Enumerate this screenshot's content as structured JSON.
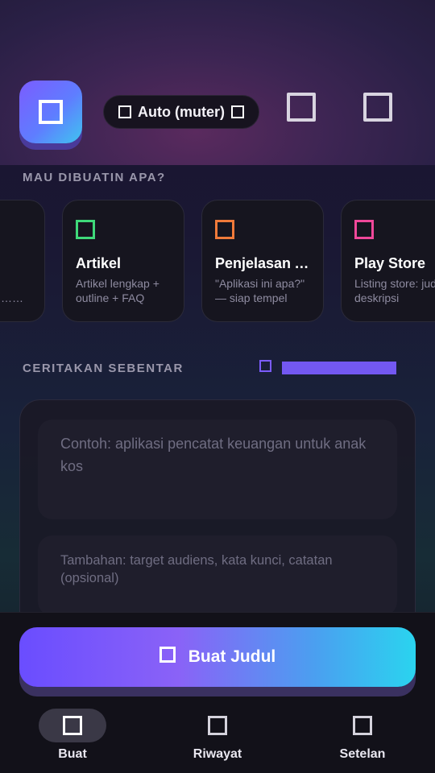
{
  "header": {
    "logo_icon": "app-logo-icon",
    "mode_label": "Auto (muter)",
    "mode_left_icon": "mode-icon",
    "mode_right_icon": "mode-toggle-icon",
    "action_icons": [
      "history-icon",
      "more-icon"
    ]
  },
  "templates": {
    "section_label": "MAU DIBUATIN APA?",
    "cards": [
      {
        "title": "",
        "desc": "…ngk…",
        "icon": "template-icon",
        "color": "#5a5a66"
      },
      {
        "title": "Artikel",
        "desc": "Artikel lengkap + outline + FAQ",
        "icon": "article-icon",
        "color": "#3fd97a"
      },
      {
        "title": "Penjelasan Aplikasi",
        "desc": "\"Aplikasi ini apa?\" — siap tempel",
        "icon": "app-explainer-icon",
        "color": "#f07a3a"
      },
      {
        "title": "Play Store",
        "desc": "Listing store: judul, deskripsi",
        "icon": "play-store-icon",
        "color": "#f0489a"
      }
    ]
  },
  "story": {
    "section_label": "CERITAKAN SEBENTAR",
    "tone_icon": "tone-icon",
    "tone_level": 1.0,
    "accent": "#7358f2",
    "main_placeholder": "Contoh: aplikasi pencatat keuangan untuk anak kos",
    "extra_placeholder": "Tambahan: target audiens, kata kunci, catatan (opsional)"
  },
  "cta": {
    "label": "Buat Judul",
    "icon": "sparkle-icon"
  },
  "bottom_nav": {
    "items": [
      {
        "label": "Buat",
        "icon": "create-icon",
        "active": true
      },
      {
        "label": "Riwayat",
        "icon": "history-icon",
        "active": false
      },
      {
        "label": "Setelan",
        "icon": "settings-icon",
        "active": false
      }
    ]
  }
}
